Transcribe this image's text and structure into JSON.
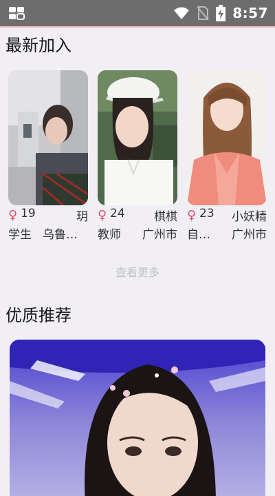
{
  "status_bar": {
    "time": "8:57"
  },
  "sections": {
    "latest_title": "最新加入",
    "recommend_title": "优质推荐"
  },
  "cards": [
    {
      "gender_symbol": "♀",
      "age": "19",
      "name": "玥",
      "job": "学生",
      "city": "乌鲁木..."
    },
    {
      "gender_symbol": "♀",
      "age": "24",
      "name": "棋棋",
      "job": "教师",
      "city": "广州市"
    },
    {
      "gender_symbol": "♀",
      "age": "23",
      "name": "小妖精",
      "job": "自由...",
      "city": "广州市"
    }
  ],
  "more_label": "查看更多",
  "colors": {
    "gender": "#e04a6e",
    "status_bar": "#6d6d6d",
    "background": "#f1eff4"
  }
}
